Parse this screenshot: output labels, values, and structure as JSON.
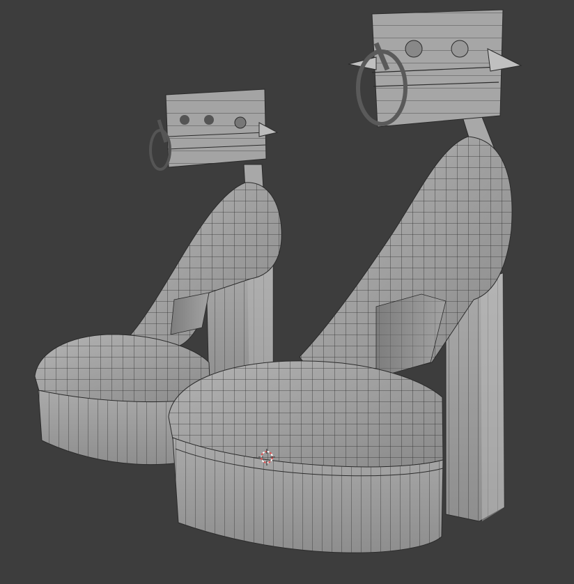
{
  "viewport": {
    "background": "#3d3d3d",
    "mesh_face_color": "#9a9a9a",
    "mesh_wire_color": "#2a2a2a",
    "cursor_colors": [
      "#e05050",
      "#ffffff"
    ]
  },
  "scene": {
    "objects": [
      "left-shoe",
      "right-shoe"
    ],
    "shoe_parts": [
      "platform-sole",
      "toe-box",
      "upper",
      "heel",
      "ankle-strap",
      "ankle-cuff",
      "spikes",
      "o-ring"
    ],
    "shading": "solid-wireframe-overlay"
  },
  "icons": {
    "cursor": "3d-cursor-icon"
  }
}
